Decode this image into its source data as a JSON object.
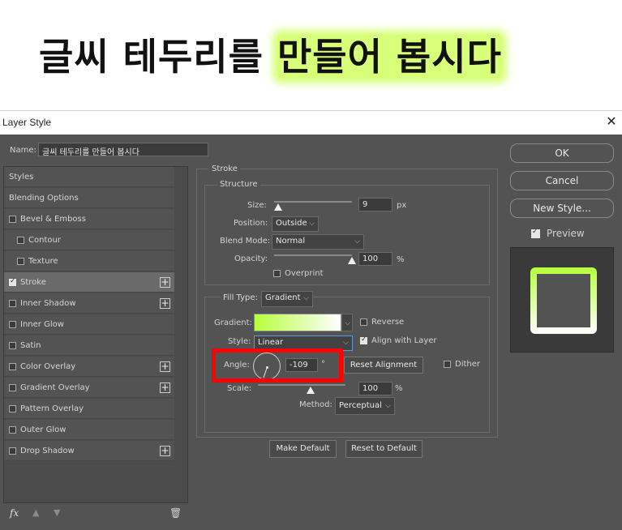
{
  "banner": {
    "title_part1": "글씨 테두리를 ",
    "title_part2": "만들어 봅시다"
  },
  "window": {
    "title": "Layer Style",
    "close_glyph": "✕"
  },
  "name_field": {
    "label": "Name:",
    "value": "글씨 테두리를 만들어 봅시다"
  },
  "sidebar": {
    "items": [
      {
        "label": "Styles"
      },
      {
        "label": "Blending Options"
      },
      {
        "label": "Bevel & Emboss"
      },
      {
        "label": "Contour"
      },
      {
        "label": "Texture"
      },
      {
        "label": "Stroke"
      },
      {
        "label": "Inner Shadow"
      },
      {
        "label": "Inner Glow"
      },
      {
        "label": "Satin"
      },
      {
        "label": "Color Overlay"
      },
      {
        "label": "Gradient Overlay"
      },
      {
        "label": "Pattern Overlay"
      },
      {
        "label": "Outer Glow"
      },
      {
        "label": "Drop Shadow"
      }
    ],
    "fx_label": "fx"
  },
  "stroke": {
    "title": "Stroke",
    "structure": {
      "legend": "Structure",
      "size_label": "Size:",
      "size_value": "9",
      "size_unit": "px",
      "size_level": 0.05,
      "position_label": "Position:",
      "position_value": "Outside",
      "blend_label": "Blend Mode:",
      "blend_value": "Normal",
      "opacity_label": "Opacity:",
      "opacity_value": "100",
      "opacity_unit": "%",
      "opacity_level": 1.0,
      "overprint_label": "Overprint"
    },
    "fill": {
      "type_label": "Fill Type:",
      "type_value": "Gradient",
      "gradient_label": "Gradient:",
      "gradient_colors": [
        "#b6ff3c",
        "#ffffff"
      ],
      "reverse_label": "Reverse",
      "style_label": "Style:",
      "style_value": "Linear",
      "align_label": "Align with Layer",
      "angle_label": "Angle:",
      "angle_value": "-109",
      "angle_unit": "°",
      "reset_alignment_label": "Reset Alignment",
      "dither_label": "Dither",
      "scale_label": "Scale:",
      "scale_value": "100",
      "scale_unit": "%",
      "scale_level": 0.6,
      "method_label": "Method:",
      "method_value": "Perceptual"
    },
    "make_default_label": "Make Default",
    "reset_default_label": "Reset to Default"
  },
  "actions": {
    "ok_label": "OK",
    "cancel_label": "Cancel",
    "new_style_label": "New Style...",
    "preview_label": "Preview"
  },
  "colors": {
    "accent_green": "#c4ff4a",
    "highlight": "#ff0000",
    "panel": "#535353"
  }
}
